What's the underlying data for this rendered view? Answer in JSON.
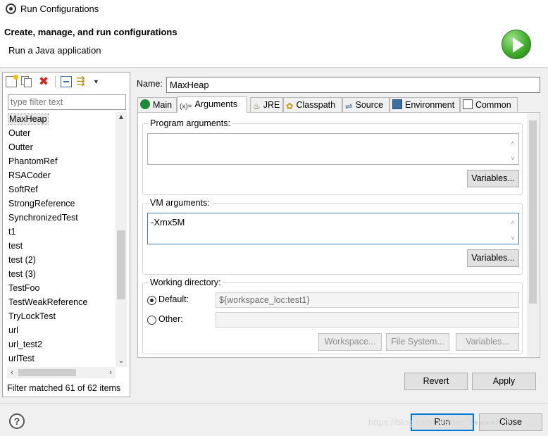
{
  "window": {
    "title": "Run Configurations"
  },
  "header": {
    "title": "Create, manage, and run configurations",
    "subtitle": "Run a Java application",
    "banner_icon": "run-icon"
  },
  "left_toolbar": {
    "icons": [
      "new-config-icon",
      "duplicate-icon",
      "delete-icon",
      "collapse-all-icon",
      "filter-icon",
      "view-menu-icon"
    ]
  },
  "filter": {
    "placeholder": "type filter text",
    "value": ""
  },
  "configs": {
    "items": [
      "MaxHeap",
      "Outer",
      "Outter",
      "PhantomRef",
      "RSACoder",
      "SoftRef",
      "StrongReference",
      "SynchronizedTest",
      "t1",
      "test",
      "test (2)",
      "test (3)",
      "TestFoo",
      "TestWeakReference",
      "TryLockTest",
      "url",
      "url_test2",
      "urlTest"
    ],
    "selected": "MaxHeap",
    "status": "Filter matched 61 of 62 items"
  },
  "name": {
    "label": "Name:",
    "value": "MaxHeap"
  },
  "tabs": [
    {
      "label": "Main",
      "icon": "main-icon"
    },
    {
      "label": "Arguments",
      "icon": "arguments-icon",
      "prefix": "(x)="
    },
    {
      "label": "JRE",
      "icon": "jre-icon"
    },
    {
      "label": "Classpath",
      "icon": "classpath-icon"
    },
    {
      "label": "Source",
      "icon": "source-icon"
    },
    {
      "label": "Environment",
      "icon": "environment-icon"
    },
    {
      "label": "Common",
      "icon": "common-icon"
    }
  ],
  "arguments": {
    "program_label": "Program arguments:",
    "program_value": "",
    "vm_label": "VM arguments:",
    "vm_value": "-Xmx5M",
    "variables_label": "Variables..."
  },
  "working_dir": {
    "label": "Working directory:",
    "default_label": "Default:",
    "default_value": "${workspace_loc:test1}",
    "other_label": "Other:",
    "other_value": "",
    "workspace_btn": "Workspace...",
    "filesystem_btn": "File System...",
    "variables_btn": "Variables..."
  },
  "actions": {
    "revert": "Revert",
    "apply": "Apply",
    "run": "Run",
    "close": "Close"
  },
  "watermark": "https://blog.csdn.net/qq_3●●●●827",
  "colors": {
    "accent": "#0078d7",
    "run_green": "#3fae2a",
    "delete_red": "#d0271d"
  }
}
